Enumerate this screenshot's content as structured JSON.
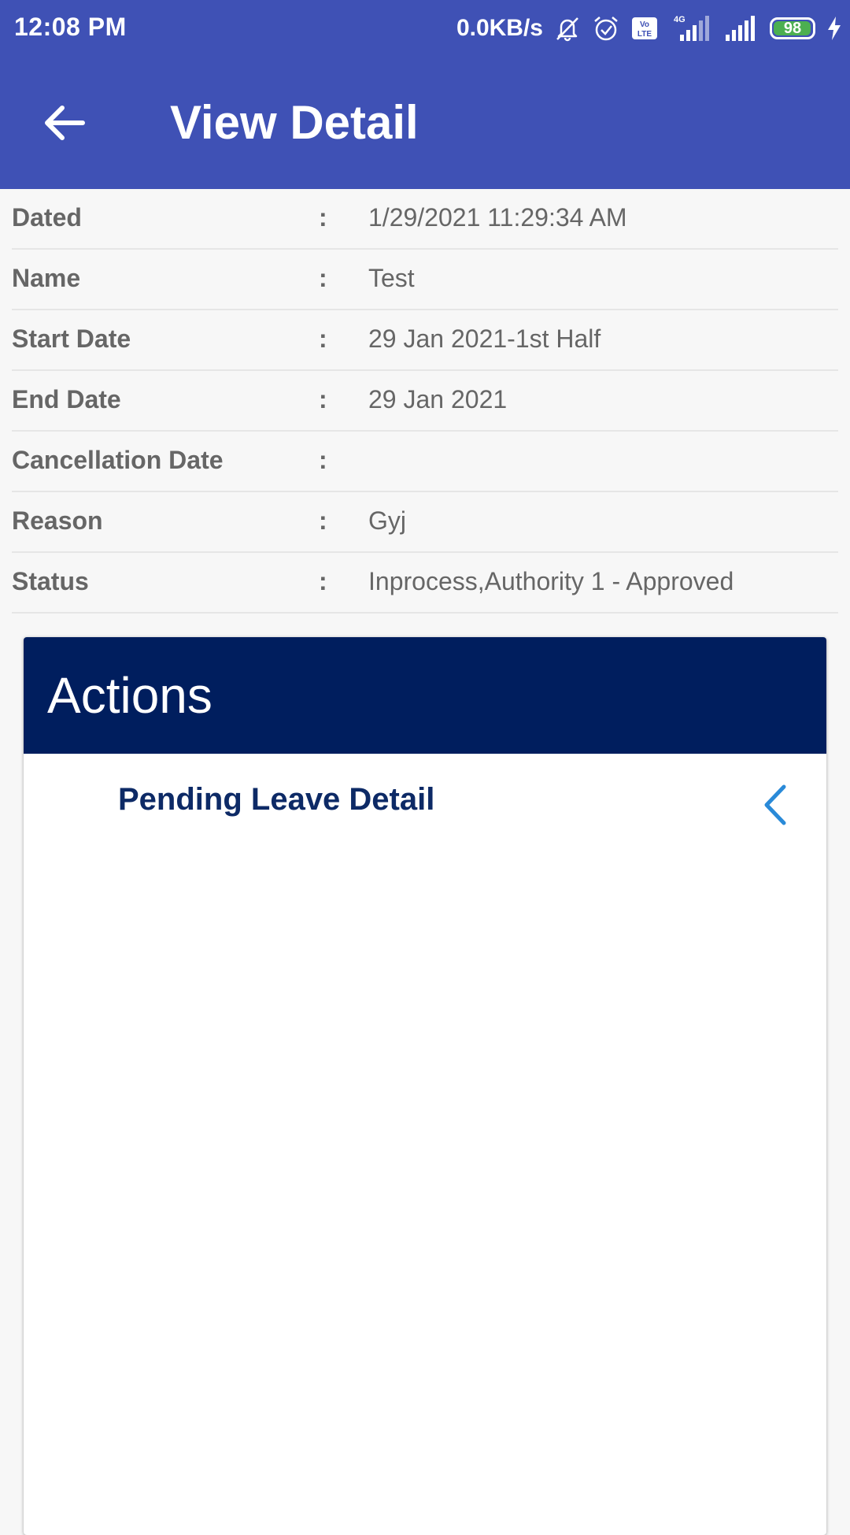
{
  "status_bar": {
    "time": "12:08 PM",
    "network_speed": "0.0KB/s",
    "volte_label": "Vo LTE",
    "network_type": "4G",
    "battery_level": "98",
    "icons": [
      "mute-icon",
      "alarm-icon",
      "volte-icon",
      "signal-4g-icon",
      "signal-icon",
      "battery-icon",
      "charging-icon"
    ],
    "battery_color": "#4caf50"
  },
  "app_bar": {
    "title": "View Detail",
    "back_icon": "arrow-left-icon",
    "background": "#3f51b5"
  },
  "details": [
    {
      "label": "Dated",
      "separator": ":",
      "value": "1/29/2021 11:29:34 AM"
    },
    {
      "label": "Name",
      "separator": ":",
      "value": "Test"
    },
    {
      "label": "Start Date",
      "separator": ":",
      "value": "29 Jan 2021-1st Half"
    },
    {
      "label": "End Date",
      "separator": ":",
      "value": "29 Jan 2021"
    },
    {
      "label": "Cancellation Date",
      "separator": ":",
      "value": ""
    },
    {
      "label": "Reason",
      "separator": ":",
      "value": "Gyj"
    },
    {
      "label": "Status",
      "separator": ":",
      "value": "Inprocess,Authority 1 - Approved"
    }
  ],
  "actions": {
    "title": "Actions",
    "header_color": "#001e5e",
    "items": [
      {
        "label": "Pending Leave Detail",
        "icon": "chevron-left-icon",
        "icon_color": "#2a8ad8"
      }
    ]
  }
}
